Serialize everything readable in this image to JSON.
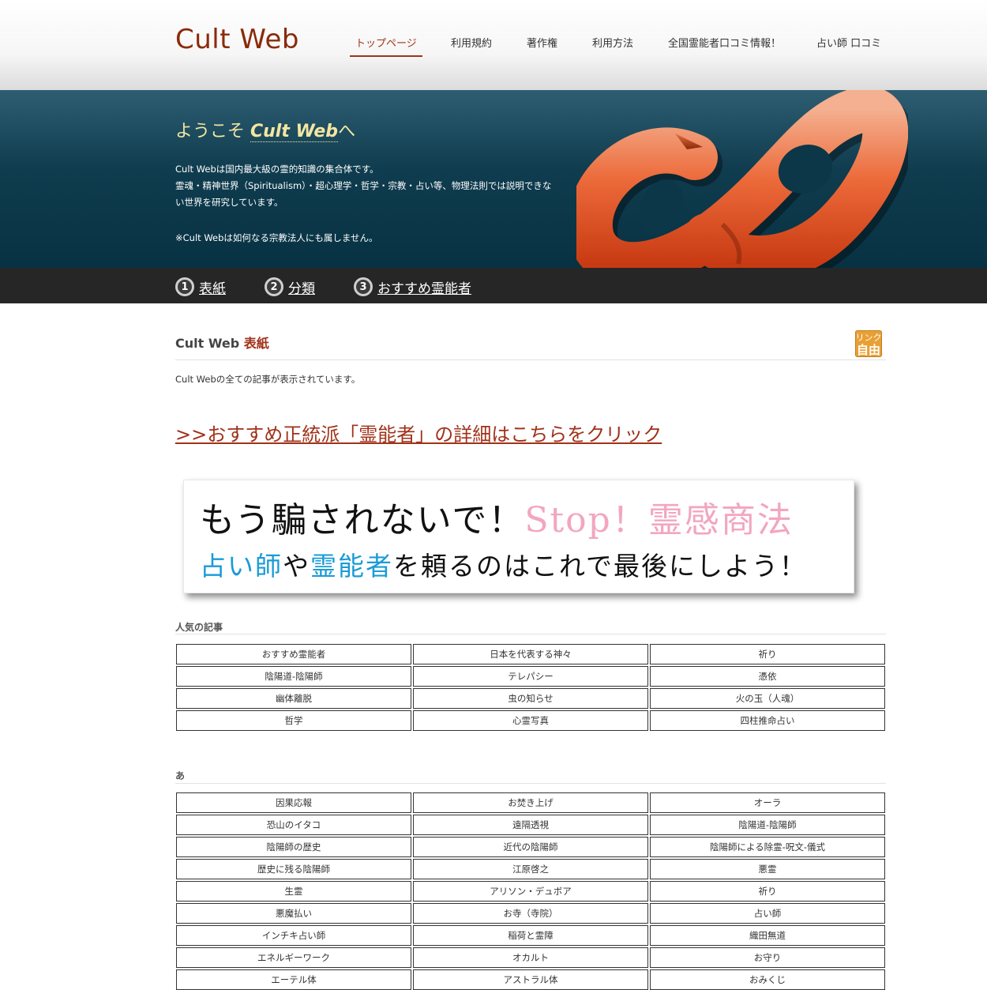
{
  "header": {
    "logo": "Cult Web",
    "nav": [
      {
        "label": "トップページ"
      },
      {
        "label": "利用規約"
      },
      {
        "label": "著作権"
      },
      {
        "label": "利用方法"
      },
      {
        "label": "全国霊能者口コミ情報！"
      },
      {
        "label": "占い師 口コミ"
      }
    ],
    "active_nav": "トップページ"
  },
  "hero": {
    "title_prefix": "ようこそ ",
    "title_brand": "Cult Web",
    "title_suffix": "へ",
    "line1": "Cult Webは国内最大級の霊的知識の集合体です。",
    "line2": "霊魂・精神世界（Spiritualism）・超心理学・哲学・宗教・占い等、物理法則では説明できない世界を研究しています。",
    "note": "※Cult Webは如何なる宗教法人にも属しません。"
  },
  "steps": [
    {
      "num": "1",
      "label": "表紙"
    },
    {
      "num": "2",
      "label": "分類"
    },
    {
      "num": "3",
      "label": "おすすめ霊能者"
    }
  ],
  "content": {
    "title_main": "Cult Web ",
    "title_accent": "表紙",
    "badge_line1": "リンク",
    "badge_line2": "自由",
    "description": "Cult Webの全ての記事が表示されています。",
    "promo_link": ">>おすすめ正統派「霊能者」の詳細はこちらをクリック",
    "banner": {
      "line1_black": "もう騙されないで！",
      "line1_pink": "Stop！霊感商法",
      "line2_blue1": "占い師",
      "line2_black1": "や",
      "line2_blue2": "霊能者",
      "line2_black2": "を頼るのはこれで最後にしよう！"
    }
  },
  "popular": {
    "title": "人気の記事",
    "items": [
      "おすすめ霊能者",
      "日本を代表する神々",
      "祈り",
      "陰陽道-陰陽師",
      "テレパシー",
      "憑依",
      "幽体離脱",
      "虫の知らせ",
      "火の玉（人魂）",
      "哲学",
      "心霊写真",
      "四柱推命占い"
    ]
  },
  "a_section": {
    "title": "あ",
    "items": [
      "因果応報",
      "お焚き上げ",
      "オーラ",
      "恐山のイタコ",
      "遠隔透視",
      "陰陽道-陰陽師",
      "陰陽師の歴史",
      "近代の陰陽師",
      "陰陽師による除霊-呪文-儀式",
      "歴史に残る陰陽師",
      "江原啓之",
      "悪霊",
      "生霊",
      "アリソン・デュボア",
      "祈り",
      "悪魔払い",
      "お寺（寺院）",
      "占い師",
      "インチキ占い師",
      "稲荷と霊障",
      "織田無道",
      "エネルギーワーク",
      "オカルト",
      "お守り",
      "エーテル体",
      "アストラル体",
      "おみくじ"
    ]
  },
  "colors": {
    "brand": "#8a2a0a",
    "accent": "#a0321a",
    "hero_bg": "#0f3c4e",
    "stepbar_bg": "#262626",
    "badge": "#e8a034",
    "banner_pink": "#f2a6c0",
    "banner_blue": "#1a9bd7"
  }
}
